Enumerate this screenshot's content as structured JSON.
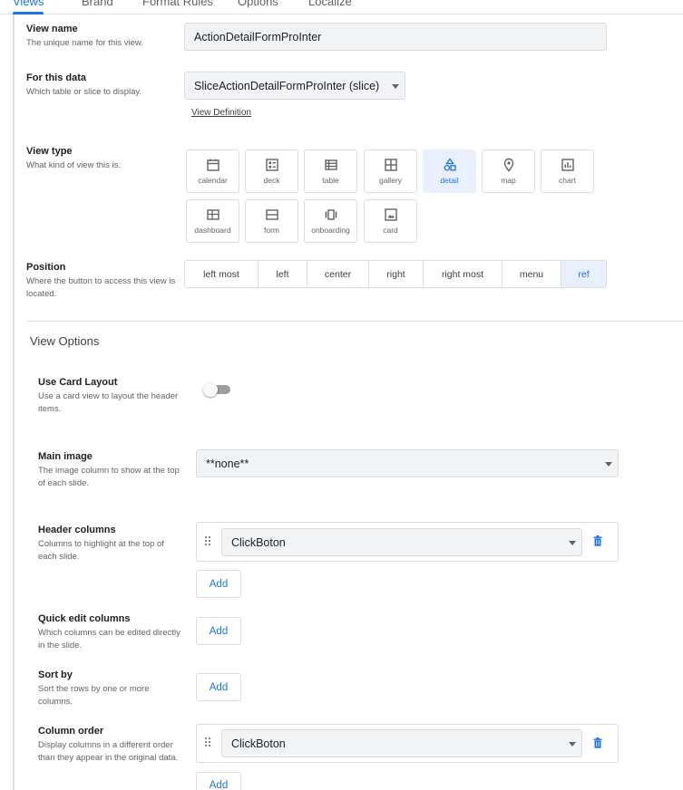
{
  "tabs": [
    {
      "label": "Views",
      "active": true
    },
    {
      "label": "Brand",
      "active": false
    },
    {
      "label": "Format Rules",
      "active": false
    },
    {
      "label": "Options",
      "active": false
    },
    {
      "label": "Localize",
      "active": false
    }
  ],
  "view_name": {
    "label": "View name",
    "desc": "The unique name for this view.",
    "value": "ActionDetailFormProInter"
  },
  "for_this_data": {
    "label": "For this data",
    "desc": "Which table or slice to display.",
    "value": "SliceActionDetailFormProInter (slice)",
    "link": "View Definition"
  },
  "view_type": {
    "label": "View type",
    "desc": "What kind of view this is.",
    "options": [
      {
        "label": "calendar",
        "icon": "calendar-icon"
      },
      {
        "label": "deck",
        "icon": "deck-icon"
      },
      {
        "label": "table",
        "icon": "table-icon"
      },
      {
        "label": "gallery",
        "icon": "gallery-icon"
      },
      {
        "label": "detail",
        "icon": "detail-shapes-icon",
        "selected": true
      },
      {
        "label": "map",
        "icon": "map-pin-icon"
      },
      {
        "label": "chart",
        "icon": "chart-icon"
      },
      {
        "label": "dashboard",
        "icon": "dashboard-icon"
      },
      {
        "label": "form",
        "icon": "form-icon"
      },
      {
        "label": "onboarding",
        "icon": "onboarding-icon"
      },
      {
        "label": "card",
        "icon": "card-image-icon"
      }
    ]
  },
  "position": {
    "label": "Position",
    "desc": "Where the button to access this view is located.",
    "options": [
      "left most",
      "left",
      "center",
      "right",
      "right most",
      "menu",
      "ref"
    ],
    "selected": "ref"
  },
  "view_options": {
    "title": "View Options",
    "use_card_layout": {
      "label": "Use Card Layout",
      "desc": "Use a card view to layout the header items.",
      "enabled": false
    },
    "main_image": {
      "label": "Main image",
      "desc": "The image column to show at the top of each slide.",
      "value": "**none**"
    },
    "header_columns": {
      "label": "Header columns",
      "desc": "Columns to highlight at the top of each slide.",
      "items": [
        "ClickBoton"
      ],
      "add_label": "Add"
    },
    "quick_edit_columns": {
      "label": "Quick edit columns",
      "desc": "Which columns can be edited directly in the slide.",
      "add_label": "Add"
    },
    "sort_by": {
      "label": "Sort by",
      "desc": "Sort the rows by one or more columns.",
      "add_label": "Add"
    },
    "column_order": {
      "label": "Column order",
      "desc": "Display columns in a different order than they appear in the original data.",
      "items": [
        "ClickBoton"
      ],
      "add_label": "Add"
    }
  },
  "colors": {
    "accent": "#1a73e8",
    "selected_bg": "#e8f0fe",
    "field_bg": "#f1f3f4",
    "border": "#dadce0"
  }
}
